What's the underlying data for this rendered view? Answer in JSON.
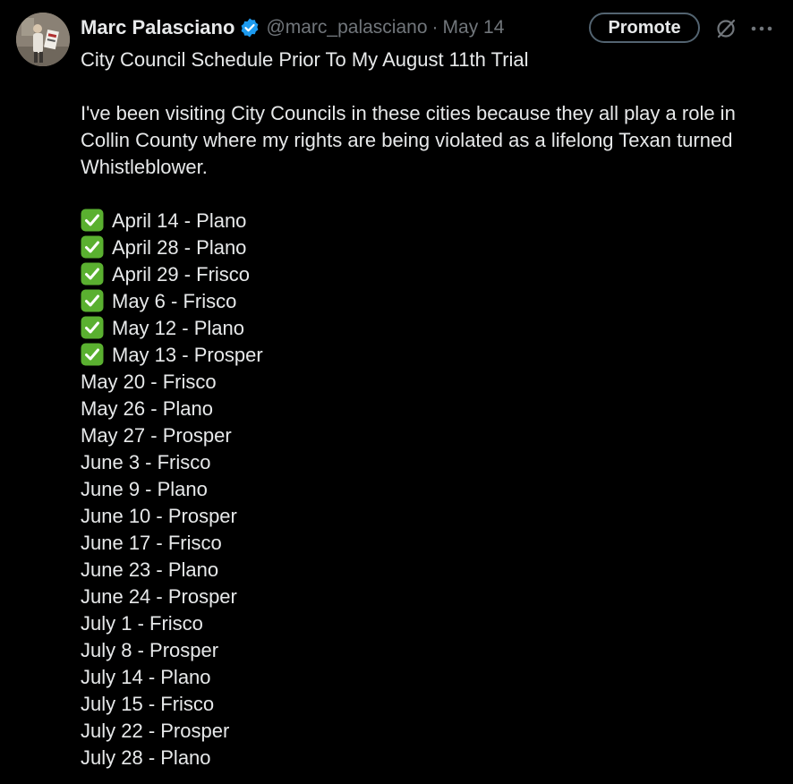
{
  "author": {
    "display_name": "Marc Palasciano",
    "handle": "@marc_palasciano",
    "separator": "·",
    "date": "May 14",
    "verified_icon": "verified-badge-icon",
    "avatar": "profile-photo-avatar"
  },
  "actions": {
    "promote_label": "Promote",
    "grok_icon": "grok-icon",
    "more_icon": "more-options-icon"
  },
  "colors": {
    "background": "#000000",
    "text": "#e7e9ea",
    "secondary_text": "#71767b",
    "verified": "#1d9bf0",
    "check_green": "#5ab030"
  },
  "tweet": {
    "title": "City Council Schedule Prior To My August 11th Trial",
    "intro_lines": [
      "I've been visiting City Councils in these cities because they all play a role in",
      "Collin County where my rights are being violated as a lifelong Texan turned",
      "Whistleblower."
    ],
    "schedule": [
      {
        "text": "April 14 - Plano",
        "done": true
      },
      {
        "text": "April 28 - Plano",
        "done": true
      },
      {
        "text": "April 29 - Frisco",
        "done": true
      },
      {
        "text": "May 6 - Frisco",
        "done": true
      },
      {
        "text": "May 12 - Plano",
        "done": true
      },
      {
        "text": "May 13 - Prosper",
        "done": true
      },
      {
        "text": "May 20 - Frisco",
        "done": false
      },
      {
        "text": "May 26 - Plano",
        "done": false
      },
      {
        "text": "May 27 - Prosper",
        "done": false
      },
      {
        "text": "June 3 - Frisco",
        "done": false
      },
      {
        "text": "June 9 - Plano",
        "done": false
      },
      {
        "text": "June 10 - Prosper",
        "done": false
      },
      {
        "text": "June 17 - Frisco",
        "done": false
      },
      {
        "text": "June 23 - Plano",
        "done": false
      },
      {
        "text": "June 24 - Prosper",
        "done": false
      },
      {
        "text": "July 1 - Frisco",
        "done": false
      },
      {
        "text": "July 8 - Prosper",
        "done": false
      },
      {
        "text": "July 14 - Plano",
        "done": false
      },
      {
        "text": "July 15 - Frisco",
        "done": false
      },
      {
        "text": "July 22 - Prosper",
        "done": false
      },
      {
        "text": "July 28 - Plano",
        "done": false
      }
    ]
  }
}
